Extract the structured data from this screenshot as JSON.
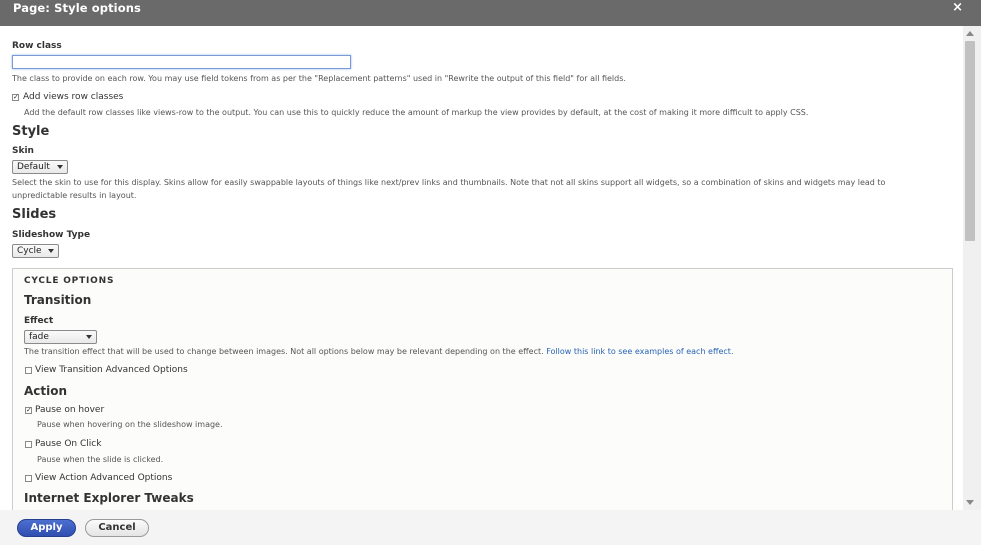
{
  "dialog": {
    "title": "Page: Style options",
    "close_glyph": "×"
  },
  "row_class": {
    "label": "Row class",
    "value": "",
    "description": "The class to provide on each row. You may use field tokens from as per the \"Replacement patterns\" used in \"Rewrite the output of this field\" for all fields."
  },
  "add_views_row_classes": {
    "label": "Add views row classes",
    "checked": true,
    "description": "Add the default row classes like views-row to the output. You can use this to quickly reduce the amount of markup the view provides by default, at the cost of making it more difficult to apply CSS."
  },
  "style": {
    "heading": "Style",
    "skin_label": "Skin",
    "skin_value": "Default",
    "skin_description_1": "Select the skin to use for this display. Skins allow for easily swappable layouts of things like next/prev links and thumbnails. Note that not all skins support all widgets, so a combination of skins and widgets may lead to",
    "skin_description_2": "unpredictable results in layout."
  },
  "slides": {
    "heading": "Slides",
    "type_label": "Slideshow Type",
    "type_value": "Cycle"
  },
  "cycle_options": {
    "legend": "CYCLE OPTIONS",
    "transition_heading": "Transition",
    "effect_label": "Effect",
    "effect_value": "fade",
    "effect_description": "The transition effect that will be used to change between images. Not all options below may be relevant depending on the effect.",
    "effect_link": "Follow this link to see examples of each effect.",
    "view_transition_advanced": "View Transition Advanced Options",
    "action_heading": "Action",
    "pause_on_hover_label": "Pause on hover",
    "pause_on_hover_checked": true,
    "pause_on_hover_description": "Pause when hovering on the slideshow image.",
    "pause_on_click_label": "Pause On Click",
    "pause_on_click_description": "Pause when the slide is clicked.",
    "view_action_advanced": "View Action Advanced Options",
    "ie_heading": "Internet Explorer Tweaks"
  },
  "footer": {
    "apply_label": "Apply",
    "cancel_label": "Cancel"
  },
  "colors": {
    "titlebar": "#6a6a6a",
    "primary_button": "#3a5bc0",
    "link": "#2764b5"
  },
  "icons": {
    "close": "close-icon",
    "checkmark": "checkmark-icon",
    "dropdown": "chevron-down-icon"
  }
}
